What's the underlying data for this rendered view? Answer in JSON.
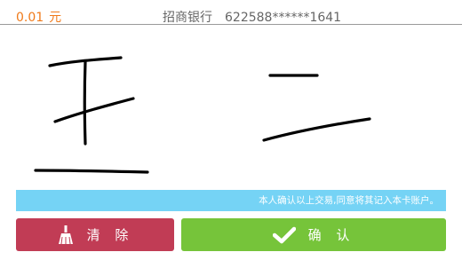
{
  "header": {
    "amount": "0.01",
    "currency": "元",
    "bank_name": "招商银行",
    "card_number": "622588******1641"
  },
  "notice": {
    "text": "本人确认以上交易,同意将其记入本卡账户。"
  },
  "buttons": {
    "clear_label": "清 除",
    "clear_icon": "broom-icon",
    "confirm_label": "确 认",
    "confirm_icon": "checkmark-icon"
  },
  "colors": {
    "amount": "#f07a1a",
    "notice_bg": "#75d3f5",
    "clear_bg": "#c13c55",
    "confirm_bg": "#76c43a",
    "stroke": "#000000"
  }
}
